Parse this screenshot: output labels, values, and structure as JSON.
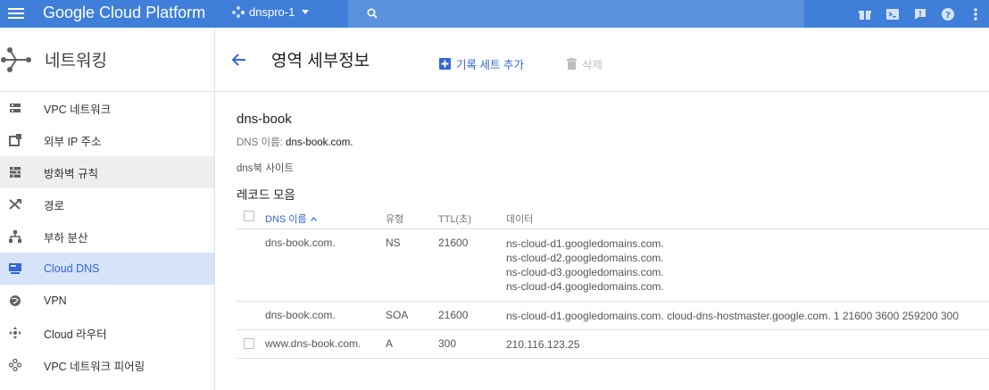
{
  "topbar": {
    "brand": "Google Cloud Platform",
    "project": "dnspro-1",
    "search_placeholder": "",
    "icons": [
      "gift-icon",
      "cloud-shell-icon",
      "notifications-icon",
      "help-icon",
      "more-vert-icon"
    ]
  },
  "sidebar": {
    "title": "네트워킹",
    "items": [
      {
        "label": "VPC 네트워크",
        "icon": "vpc-network-icon"
      },
      {
        "label": "외부 IP 주소",
        "icon": "external-ip-icon"
      },
      {
        "label": "방화벽 규칙",
        "icon": "firewall-icon"
      },
      {
        "label": "경로",
        "icon": "routes-icon"
      },
      {
        "label": "부하 분산",
        "icon": "load-balancing-icon"
      },
      {
        "label": "Cloud DNS",
        "icon": "cloud-dns-icon"
      },
      {
        "label": "VPN",
        "icon": "vpn-icon"
      },
      {
        "label": "Cloud 라우터",
        "icon": "cloud-router-icon"
      },
      {
        "label": "VPC 네트워크 피어링",
        "icon": "vpc-peering-icon"
      }
    ],
    "active_index": 5,
    "hover_index": 2
  },
  "main": {
    "title": "영역 세부정보",
    "add_label": "기록 세트 추가",
    "delete_label": "삭제",
    "zone_name": "dns-book",
    "dns_name_label": "DNS 이름:",
    "dns_name_value": "dns-book.com.",
    "description": "dns북 사이트",
    "records_title": "레코드 모음",
    "columns": {
      "name": "DNS 이름",
      "type": "유형",
      "ttl": "TTL(초)",
      "data": "데이터"
    },
    "records": [
      {
        "name": "dns-book.com.",
        "type": "NS",
        "ttl": "21600",
        "data_line_0": "ns-cloud-d1.googledomains.com.",
        "data_line_1": "ns-cloud-d2.googledomains.com.",
        "data_line_2": "ns-cloud-d3.googledomains.com.",
        "data_line_3": "ns-cloud-d4.googledomains.com.",
        "checkbox": false
      },
      {
        "name": "dns-book.com.",
        "type": "SOA",
        "ttl": "21600",
        "data_line_0": "ns-cloud-d1.googledomains.com. cloud-dns-hostmaster.google.com. 1 21600 3600 259200 300",
        "checkbox": false
      },
      {
        "name": "www.dns-book.com.",
        "type": "A",
        "ttl": "300",
        "data_line_0": "210.116.123.25",
        "checkbox": true
      }
    ]
  },
  "colors": {
    "topbar": "#3f7fd9",
    "search": "#5b92df",
    "accent": "#3367d6",
    "active_bg": "#d6e3f8"
  }
}
